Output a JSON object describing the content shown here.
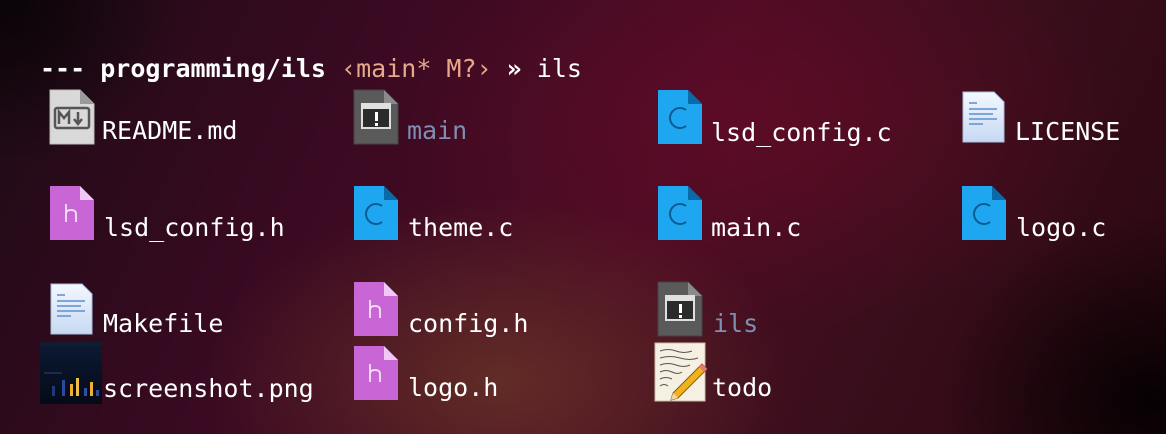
{
  "terminal": {
    "prompt": {
      "dashes": "---",
      "path": "programming/ils",
      "git_status": "‹main* M?›",
      "arrow": "»",
      "command": "ils"
    },
    "files": [
      {
        "name": "README.md",
        "icon": "markdown-file-icon",
        "kind": "markdown"
      },
      {
        "name": "main",
        "icon": "executable-file-icon",
        "kind": "executable"
      },
      {
        "name": "lsd_config.c",
        "icon": "c-source-file-icon",
        "kind": "c"
      },
      {
        "name": "LICENSE",
        "icon": "text-file-icon",
        "kind": "text"
      },
      {
        "name": "lsd_config.h",
        "icon": "header-file-icon",
        "kind": "h"
      },
      {
        "name": "theme.c",
        "icon": "c-source-file-icon",
        "kind": "c"
      },
      {
        "name": "main.c",
        "icon": "c-source-file-icon",
        "kind": "c"
      },
      {
        "name": "logo.c",
        "icon": "c-source-file-icon",
        "kind": "c"
      },
      {
        "name": "Makefile",
        "icon": "text-file-icon",
        "kind": "text"
      },
      {
        "name": "config.h",
        "icon": "header-file-icon",
        "kind": "h"
      },
      {
        "name": "ils",
        "icon": "executable-file-icon",
        "kind": "executable"
      },
      {
        "name": "screenshot.png",
        "icon": "image-thumbnail-icon",
        "kind": "image"
      },
      {
        "name": "logo.h",
        "icon": "header-file-icon",
        "kind": "h"
      },
      {
        "name": "todo",
        "icon": "notepad-pencil-icon",
        "kind": "notes"
      }
    ],
    "colors": {
      "filename": "#ffffff",
      "executable": "#7f8fb3",
      "git_status": "#e8a98a",
      "c_icon": "#1ea7f0",
      "h_icon": "#c966d6",
      "exec_icon": "#5a5a5a"
    }
  }
}
